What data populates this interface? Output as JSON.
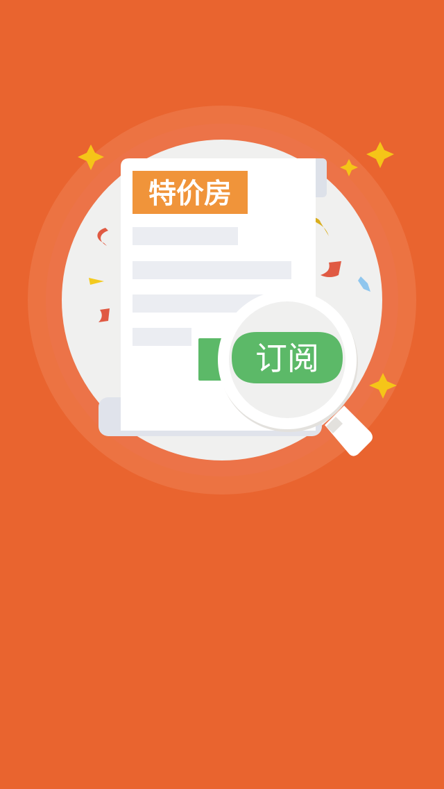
{
  "screen": {
    "name": "splash-special-price-subscription",
    "background_color": "#E9642F"
  },
  "tag": {
    "label": "特价房",
    "color": "#F0943A",
    "text_color": "#FFFFFF"
  },
  "subscribe_badge": {
    "label": "订阅",
    "color": "#5CB968",
    "text_color": "#FFFFFF"
  },
  "colors": {
    "halo_outer": "#EE8052",
    "halo_inner": "#EC7349",
    "circle_fill": "#F0F0EF",
    "paper": "#FFFFFF",
    "paper_shadow": "#E0E3EB",
    "placeholder_line": "#EBEDF2",
    "sparkle": "#F5C518",
    "confetti_red": "#E05A43",
    "confetti_blue": "#8FC6EE",
    "confetti_yellow": "#F3CA1E",
    "magnifier_ring": "#FFFFFF",
    "magnifier_ring_shadow": "#E3E1DD"
  },
  "icons": [
    "sparkle-icon",
    "confetti-icon",
    "document-icon",
    "magnifier-icon"
  ]
}
